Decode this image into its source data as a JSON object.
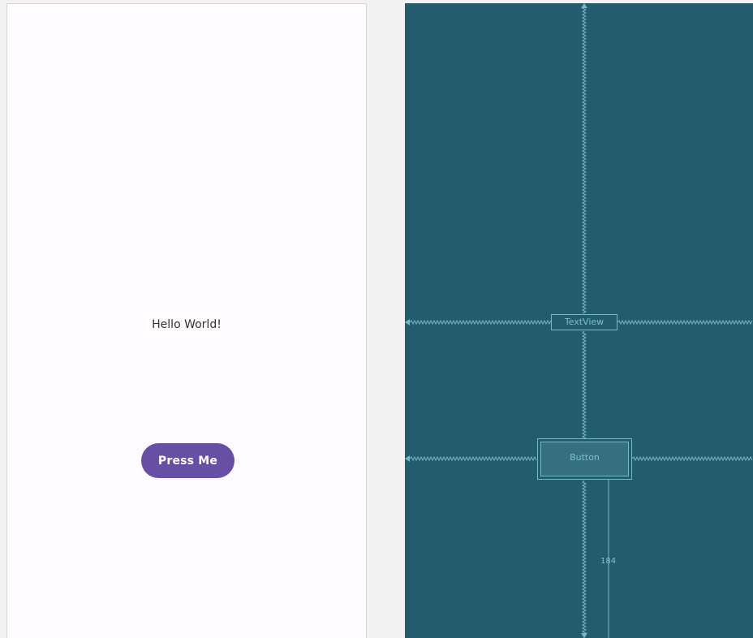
{
  "design_preview": {
    "text_view": "Hello World!",
    "button_label": "Press Me"
  },
  "blueprint": {
    "text_view_label": "TextView",
    "button_label": "Button",
    "bottom_margin": "184"
  },
  "colors": {
    "preview_background": "#fffbfe",
    "button_fill": "#6750a4",
    "blueprint_background": "#235c6c",
    "blueprint_line": "#73b8c6"
  }
}
